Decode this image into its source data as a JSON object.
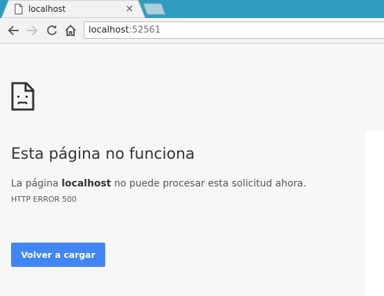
{
  "tab": {
    "title": "localhost",
    "close_glyph": "×"
  },
  "omnibox": {
    "host": "localhost",
    "port": ":52561"
  },
  "error": {
    "title": "Esta página no funciona",
    "desc_prefix": "La página ",
    "desc_host": "localhost",
    "desc_suffix": " no puede procesar esta solicitud ahora.",
    "code": "HTTP ERROR 500",
    "reload_label": "Volver a cargar"
  },
  "icons": {
    "tab_favicon": "page-icon",
    "back": "arrow-left-icon",
    "forward": "arrow-right-icon",
    "reload": "reload-icon",
    "home": "home-icon",
    "error": "sad-page-icon"
  },
  "colors": {
    "tabstrip": "#2e9cbc",
    "button": "#4285f4",
    "content_bg": "#f7f7f7"
  }
}
